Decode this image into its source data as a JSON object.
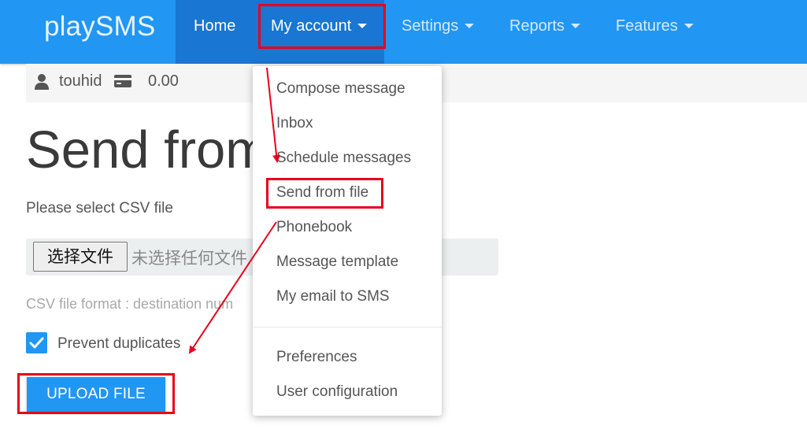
{
  "brand": "playSMS",
  "nav": {
    "home": "Home",
    "my_account": "My account",
    "settings": "Settings",
    "reports": "Reports",
    "features": "Features"
  },
  "info": {
    "user_icon": "user-icon",
    "username": "touhid",
    "credit_icon": "credit-card-icon",
    "credit": "0.00"
  },
  "page": {
    "title": "Send from",
    "csv_label": "Please select CSV file",
    "file_button": "选择文件",
    "file_status": "未选择任何文件",
    "hint": "CSV file format : destination num",
    "prevent_duplicates": "Prevent duplicates",
    "prevent_duplicates_checked": true,
    "upload_button": "UPLOAD FILE"
  },
  "dropdown": {
    "items": [
      "Compose message",
      "Inbox",
      "Schedule messages",
      "Send from file",
      "Phonebook",
      "Message template",
      "My email to SMS"
    ],
    "items_after_divider": [
      "Preferences",
      "User configuration"
    ]
  },
  "colors": {
    "navbar": "#2196f3",
    "nav_active": "#1976d2",
    "annotation": "#e8001c"
  }
}
